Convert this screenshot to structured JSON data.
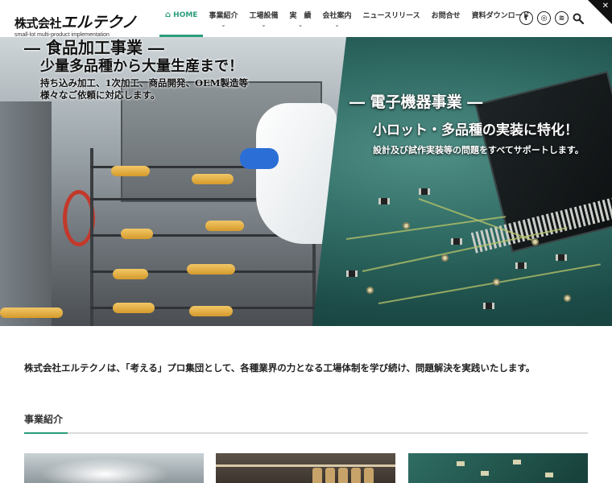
{
  "header": {
    "logo_main_prefix": "株式会社",
    "logo_main_brand": "エルテクノ",
    "logo_sub": "small-lot multi-product implementation",
    "nav": [
      {
        "label": "HOME",
        "icon": "home-icon",
        "active": true,
        "has_dropdown": false
      },
      {
        "label": "事業紹介",
        "active": false,
        "has_dropdown": true
      },
      {
        "label": "工場設備",
        "active": false,
        "has_dropdown": true
      },
      {
        "label": "実　績",
        "active": false,
        "has_dropdown": true
      },
      {
        "label": "会社案内",
        "active": false,
        "has_dropdown": true
      },
      {
        "label": "ニュースリリース",
        "active": false,
        "has_dropdown": false
      },
      {
        "label": "お問合せ",
        "active": false,
        "has_dropdown": false
      },
      {
        "label": "資料ダウンロード",
        "active": false,
        "has_dropdown": false
      }
    ],
    "social": [
      {
        "name": "facebook-icon",
        "glyph": "f"
      },
      {
        "name": "instagram-icon",
        "glyph": "◎"
      },
      {
        "name": "rss-icon",
        "glyph": "≋"
      }
    ],
    "close_glyph": "✕",
    "accent_color": "#2a9d7c"
  },
  "hero": {
    "left": {
      "title": "― 食品加工事業 ―",
      "lead": "少量多品種から大量生産まで！",
      "desc_line1": "持ち込み加工、1次加工、商品開発、OEM製造等",
      "desc_line2": "様々なご依頼に対応します。"
    },
    "right": {
      "title": "― 電子機器事業 ―",
      "lead": "小ロット・多品種の実装に特化！",
      "desc": "設計及び試作実装等の問題をすべてサポートします。"
    }
  },
  "main": {
    "tagline": "株式会社エルテクノは、「考える」プロ集団として、各種業界の力となる工場体制を学び続け、問題解決を実践いたします。",
    "section_title": "事業紹介"
  }
}
